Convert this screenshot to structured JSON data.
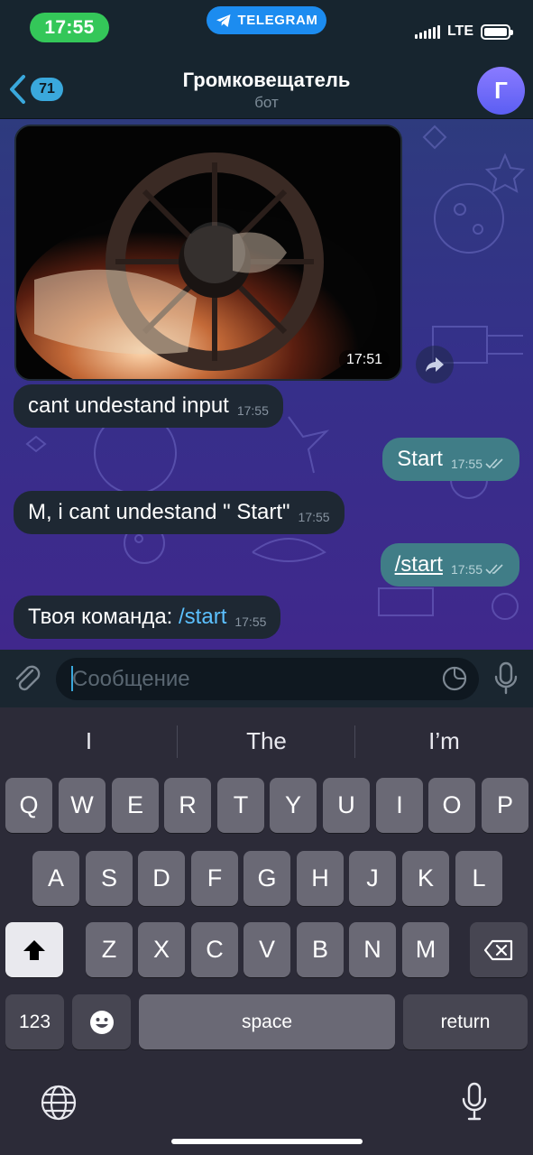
{
  "status_bar": {
    "time": "17:55",
    "app_pill": "TELEGRAM",
    "network": "LTE"
  },
  "header": {
    "back_count": "71",
    "title": "Громковещатель",
    "subtitle": "бот",
    "avatar_letter": "Г"
  },
  "messages": {
    "media_time": "17:51",
    "m1": {
      "text": "cant undestand input",
      "time": "17:55"
    },
    "m2": {
      "text": "Start",
      "time": "17:55"
    },
    "m3": {
      "text": "M, i cant undestand \" Start\"",
      "time": "17:55"
    },
    "m4": {
      "text": "/start",
      "time": "17:55"
    },
    "m5": {
      "prefix": "Твоя команда: ",
      "link": "/start",
      "time": "17:55"
    }
  },
  "input": {
    "placeholder": "Сообщение"
  },
  "keyboard": {
    "suggestions": [
      "I",
      "The",
      "I’m"
    ],
    "row1": [
      "Q",
      "W",
      "E",
      "R",
      "T",
      "Y",
      "U",
      "I",
      "O",
      "P"
    ],
    "row2": [
      "A",
      "S",
      "D",
      "F",
      "G",
      "H",
      "J",
      "K",
      "L"
    ],
    "row3": [
      "Z",
      "X",
      "C",
      "V",
      "B",
      "N",
      "M"
    ],
    "numbers_key": "123",
    "space_key": "space",
    "return_key": "return"
  },
  "colors": {
    "header_bg": "#17252f",
    "incoming_bubble": "#1e2833",
    "outgoing_bubble": "#407d87",
    "accent": "#3aa8dc",
    "link": "#5cc1ff",
    "time_pill": "#34c759",
    "telegram_pill": "#1c8cf0",
    "keyboard_bg": "#2c2b38"
  },
  "icons": [
    "back-chevron-icon",
    "telegram-icon",
    "signal-icon",
    "battery-icon",
    "share-icon",
    "attach-icon",
    "sticker-icon",
    "mic-icon",
    "shift-icon",
    "backspace-icon",
    "emoji-icon",
    "globe-icon",
    "dictation-icon",
    "read-checks-icon"
  ]
}
